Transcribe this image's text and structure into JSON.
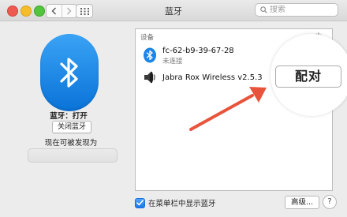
{
  "window": {
    "title": "蓝牙"
  },
  "search": {
    "placeholder": "搜索"
  },
  "left_pane": {
    "status": "蓝牙：打开",
    "toggle_button": "关闭蓝牙",
    "discoverable_text": "现在可被发现为"
  },
  "device_list": {
    "header": "设备",
    "devices": [
      {
        "name": "fc-62-b9-39-67-28",
        "status": "未连接",
        "icon": "bluetooth-icon"
      },
      {
        "name": "Jabra Rox Wireless v2.5.3",
        "status": "",
        "icon": "speaker-icon"
      }
    ]
  },
  "pair_button": {
    "label": "配对"
  },
  "bottom": {
    "show_in_menubar_label": "在菜单栏中显示蓝牙",
    "show_in_menubar_checked": true,
    "advanced_button": "高级...",
    "help_button": "?"
  },
  "colors": {
    "bluetooth_blue": "#1a85ea",
    "annotation_arrow": "#e8543b",
    "checkbox_accent": "#1a7ae8"
  }
}
